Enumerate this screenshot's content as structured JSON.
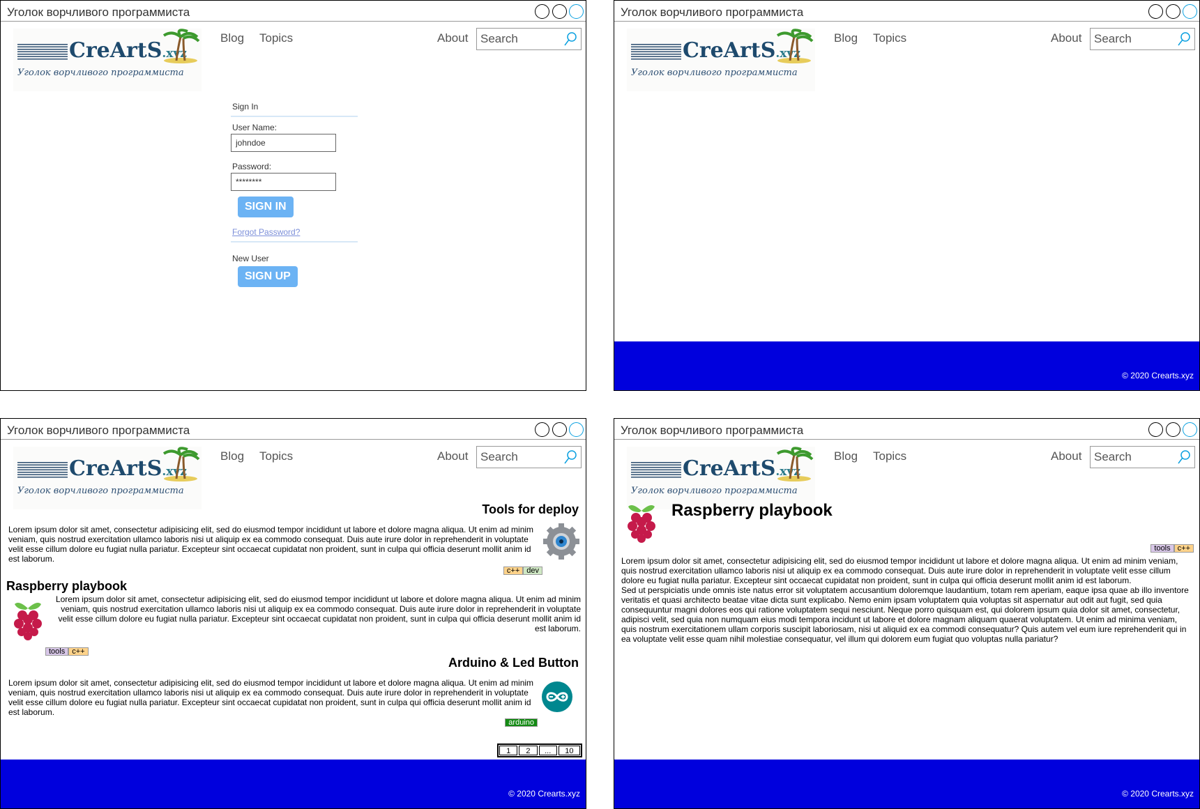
{
  "site": {
    "window_title": "Уголок ворчливого программиста",
    "brand": "CreArtS",
    "brand_suffix": ".xyz",
    "tagline": "Уголок ворчливого программиста",
    "nav": {
      "blog": "Blog",
      "topics": "Topics",
      "about": "About"
    },
    "search_placeholder": "Search",
    "footer": "© 2020 Crearts.xyz",
    "footer_color": "#0000dd"
  },
  "login": {
    "heading": "Sign In",
    "username_label": "User Name:",
    "username_value": "johndoe",
    "password_label": "Password:",
    "password_value": "********",
    "signin_button": "SIGN IN",
    "forgot": "Forgot Password?",
    "new_user": "New User",
    "signup_button": "SIGN UP",
    "button_color": "#6cb3f4"
  },
  "list": {
    "posts": [
      {
        "title": "Tools for deploy",
        "text": "Lorem ipsum dolor sit amet, consectetur adipisicing elit, sed do eiusmod tempor incididunt ut labore et dolore magna aliqua. Ut enim ad minim veniam, quis nostrud exercitation ullamco laboris nisi ut aliquip ex ea commodo consequat. Duis aute irure dolor in reprehenderit in voluptate velit esse cillum dolore eu fugiat nulla pariatur. Excepteur sint occaecat cupidatat non proident, sunt in culpa qui officia deserunt mollit anim id est laborum.",
        "tags": [
          "c++",
          "dev"
        ],
        "icon": "gear-icon"
      },
      {
        "title": "Raspberry playbook",
        "text": "Lorem ipsum dolor sit amet, consectetur adipisicing elit, sed do eiusmod tempor incididunt ut labore et dolore magna aliqua. Ut enim ad minim veniam, quis nostrud exercitation ullamco laboris nisi ut aliquip ex ea commodo consequat. Duis aute irure dolor in reprehenderit in voluptate velit esse cillum dolore eu fugiat nulla pariatur. Excepteur sint occaecat cupidatat non proident, sunt in culpa qui officia deserunt mollit anim id est laborum.",
        "tags": [
          "tools",
          "c++"
        ],
        "icon": "raspberry-icon"
      },
      {
        "title": "Arduino & Led Button",
        "text": "Lorem ipsum dolor sit amet, consectetur adipisicing elit, sed do eiusmod tempor incididunt ut labore et dolore magna aliqua. Ut enim ad minim veniam, quis nostrud exercitation ullamco laboris nisi ut aliquip ex ea commodo consequat. Duis aute irure dolor in reprehenderit in voluptate velit esse cillum dolore eu fugiat nulla pariatur. Excepteur sint occaecat cupidatat non proident, sunt in culpa qui officia deserunt mollit anim id est laborum.",
        "tags": [
          "arduino"
        ],
        "icon": "arduino-icon"
      }
    ],
    "pager": [
      "1",
      "2",
      "...",
      "10"
    ]
  },
  "post": {
    "title": "Raspberry playbook",
    "tags": [
      "tools",
      "c++"
    ],
    "para1": "Lorem ipsum dolor sit amet, consectetur adipisicing elit, sed do eiusmod tempor incididunt ut labore et dolore magna aliqua. Ut enim ad minim veniam, quis nostrud exercitation ullamco laboris nisi ut aliquip ex ea commodo consequat. Duis aute irure dolor in reprehenderit in voluptate velit esse cillum dolore eu fugiat nulla pariatur. Excepteur sint occaecat cupidatat non proident, sunt in culpa qui officia deserunt mollit anim id est laborum.",
    "para2": "Sed ut perspiciatis unde omnis iste natus error sit voluptatem accusantium doloremque laudantium, totam rem aperiam, eaque ipsa quae ab illo inventore veritatis et quasi architecto beatae vitae dicta sunt explicabo. Nemo enim ipsam voluptatem quia voluptas sit aspernatur aut odit aut fugit, sed quia consequuntur magni dolores eos qui ratione voluptatem sequi nesciunt. Neque porro quisquam est, qui dolorem ipsum quia dolor sit amet, consectetur, adipisci velit, sed quia non numquam eius modi tempora incidunt ut labore et dolore magnam aliquam quaerat voluptatem. Ut enim ad minima veniam, quis nostrum exercitationem ullam corporis suscipit laboriosam, nisi ut aliquid ex ea commodi consequatur? Quis autem vel eum iure reprehenderit qui in ea voluptate velit esse quam nihil molestiae consequatur, vel illum qui dolorem eum fugiat quo voluptas nulla pariatur?"
  },
  "tag_colors": {
    "c++": "#ffd38a",
    "dev": "#cfe8c4",
    "tools": "#d8c7e8",
    "arduino": "#138a13"
  }
}
